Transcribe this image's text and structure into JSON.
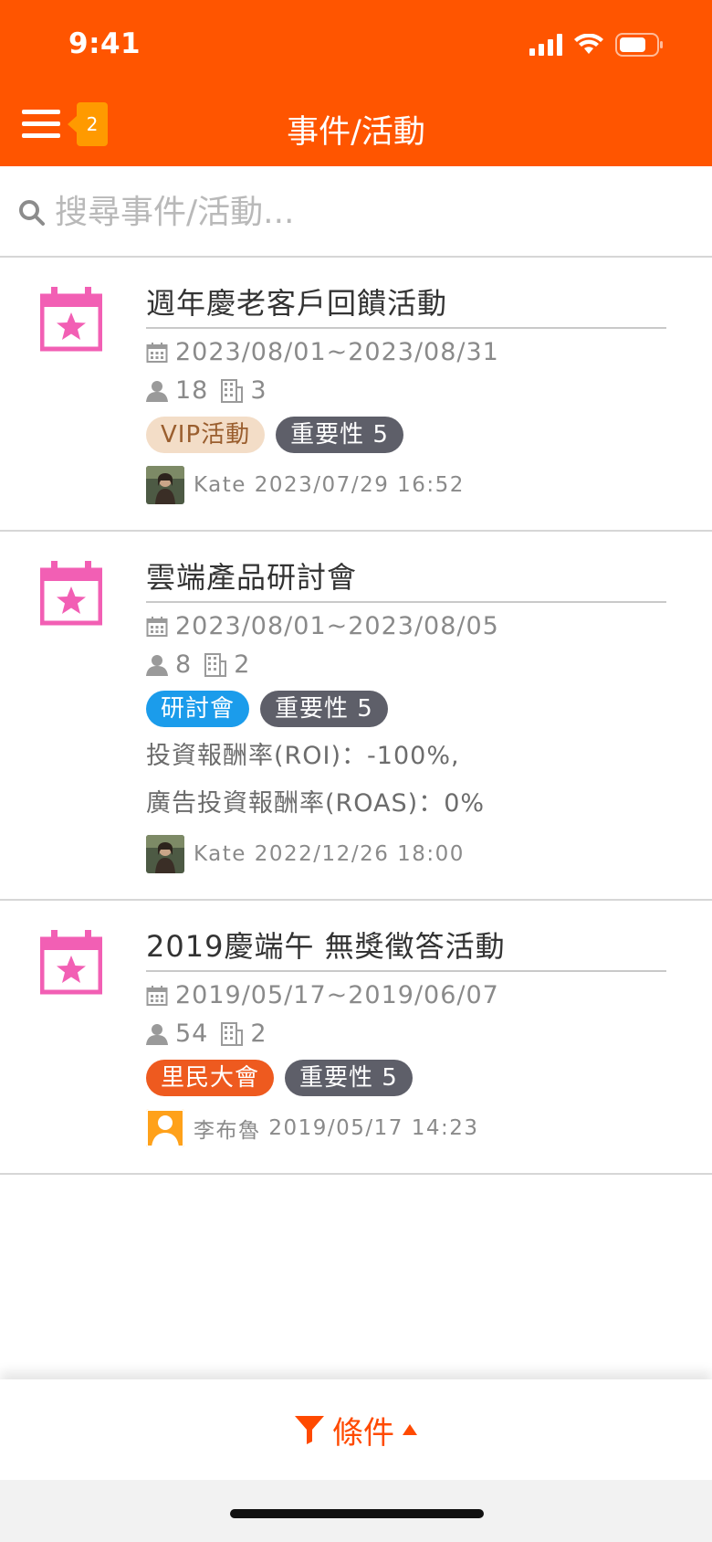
{
  "status_bar": {
    "time": "9:41"
  },
  "header": {
    "title": "事件/活動",
    "badge_count": "2"
  },
  "search": {
    "placeholder": "搜尋事件/活動..."
  },
  "events": [
    {
      "title": "週年慶老客戶回饋活動",
      "date_range": "2023/08/01~2023/08/31",
      "people_count": "18",
      "company_count": "3",
      "tags": [
        "VIP活動",
        "重要性 5"
      ],
      "author": "Kate",
      "timestamp": "2023/07/29 16:52"
    },
    {
      "title": "雲端產品研討會",
      "date_range": "2023/08/01~2023/08/05",
      "people_count": "8",
      "company_count": "2",
      "tags": [
        "研討會",
        "重要性 5"
      ],
      "roi": "投資報酬率(ROI)：-100%,",
      "roas": "廣告投資報酬率(ROAS)：0%",
      "author": "Kate",
      "timestamp": "2022/12/26 18:00"
    },
    {
      "title": "2019慶端午 無獎徵答活動",
      "date_range": "2019/05/17~2019/06/07",
      "people_count": "54",
      "company_count": "2",
      "tags": [
        "里民大會",
        "重要性 5"
      ],
      "author": "李布魯",
      "timestamp": "2019/05/17 14:23"
    }
  ],
  "footer": {
    "filter_label": "條件"
  },
  "colors": {
    "header_bg": "#FF5500",
    "calendar_icon": "#F25FB4",
    "tag_vip_bg": "#F3DDC7",
    "tag_seminar_bg": "#1B9CEB",
    "tag_meeting_bg": "#EE5A1F",
    "tag_importance_bg": "#5E5F69",
    "filter_accent": "#FF4A00"
  }
}
